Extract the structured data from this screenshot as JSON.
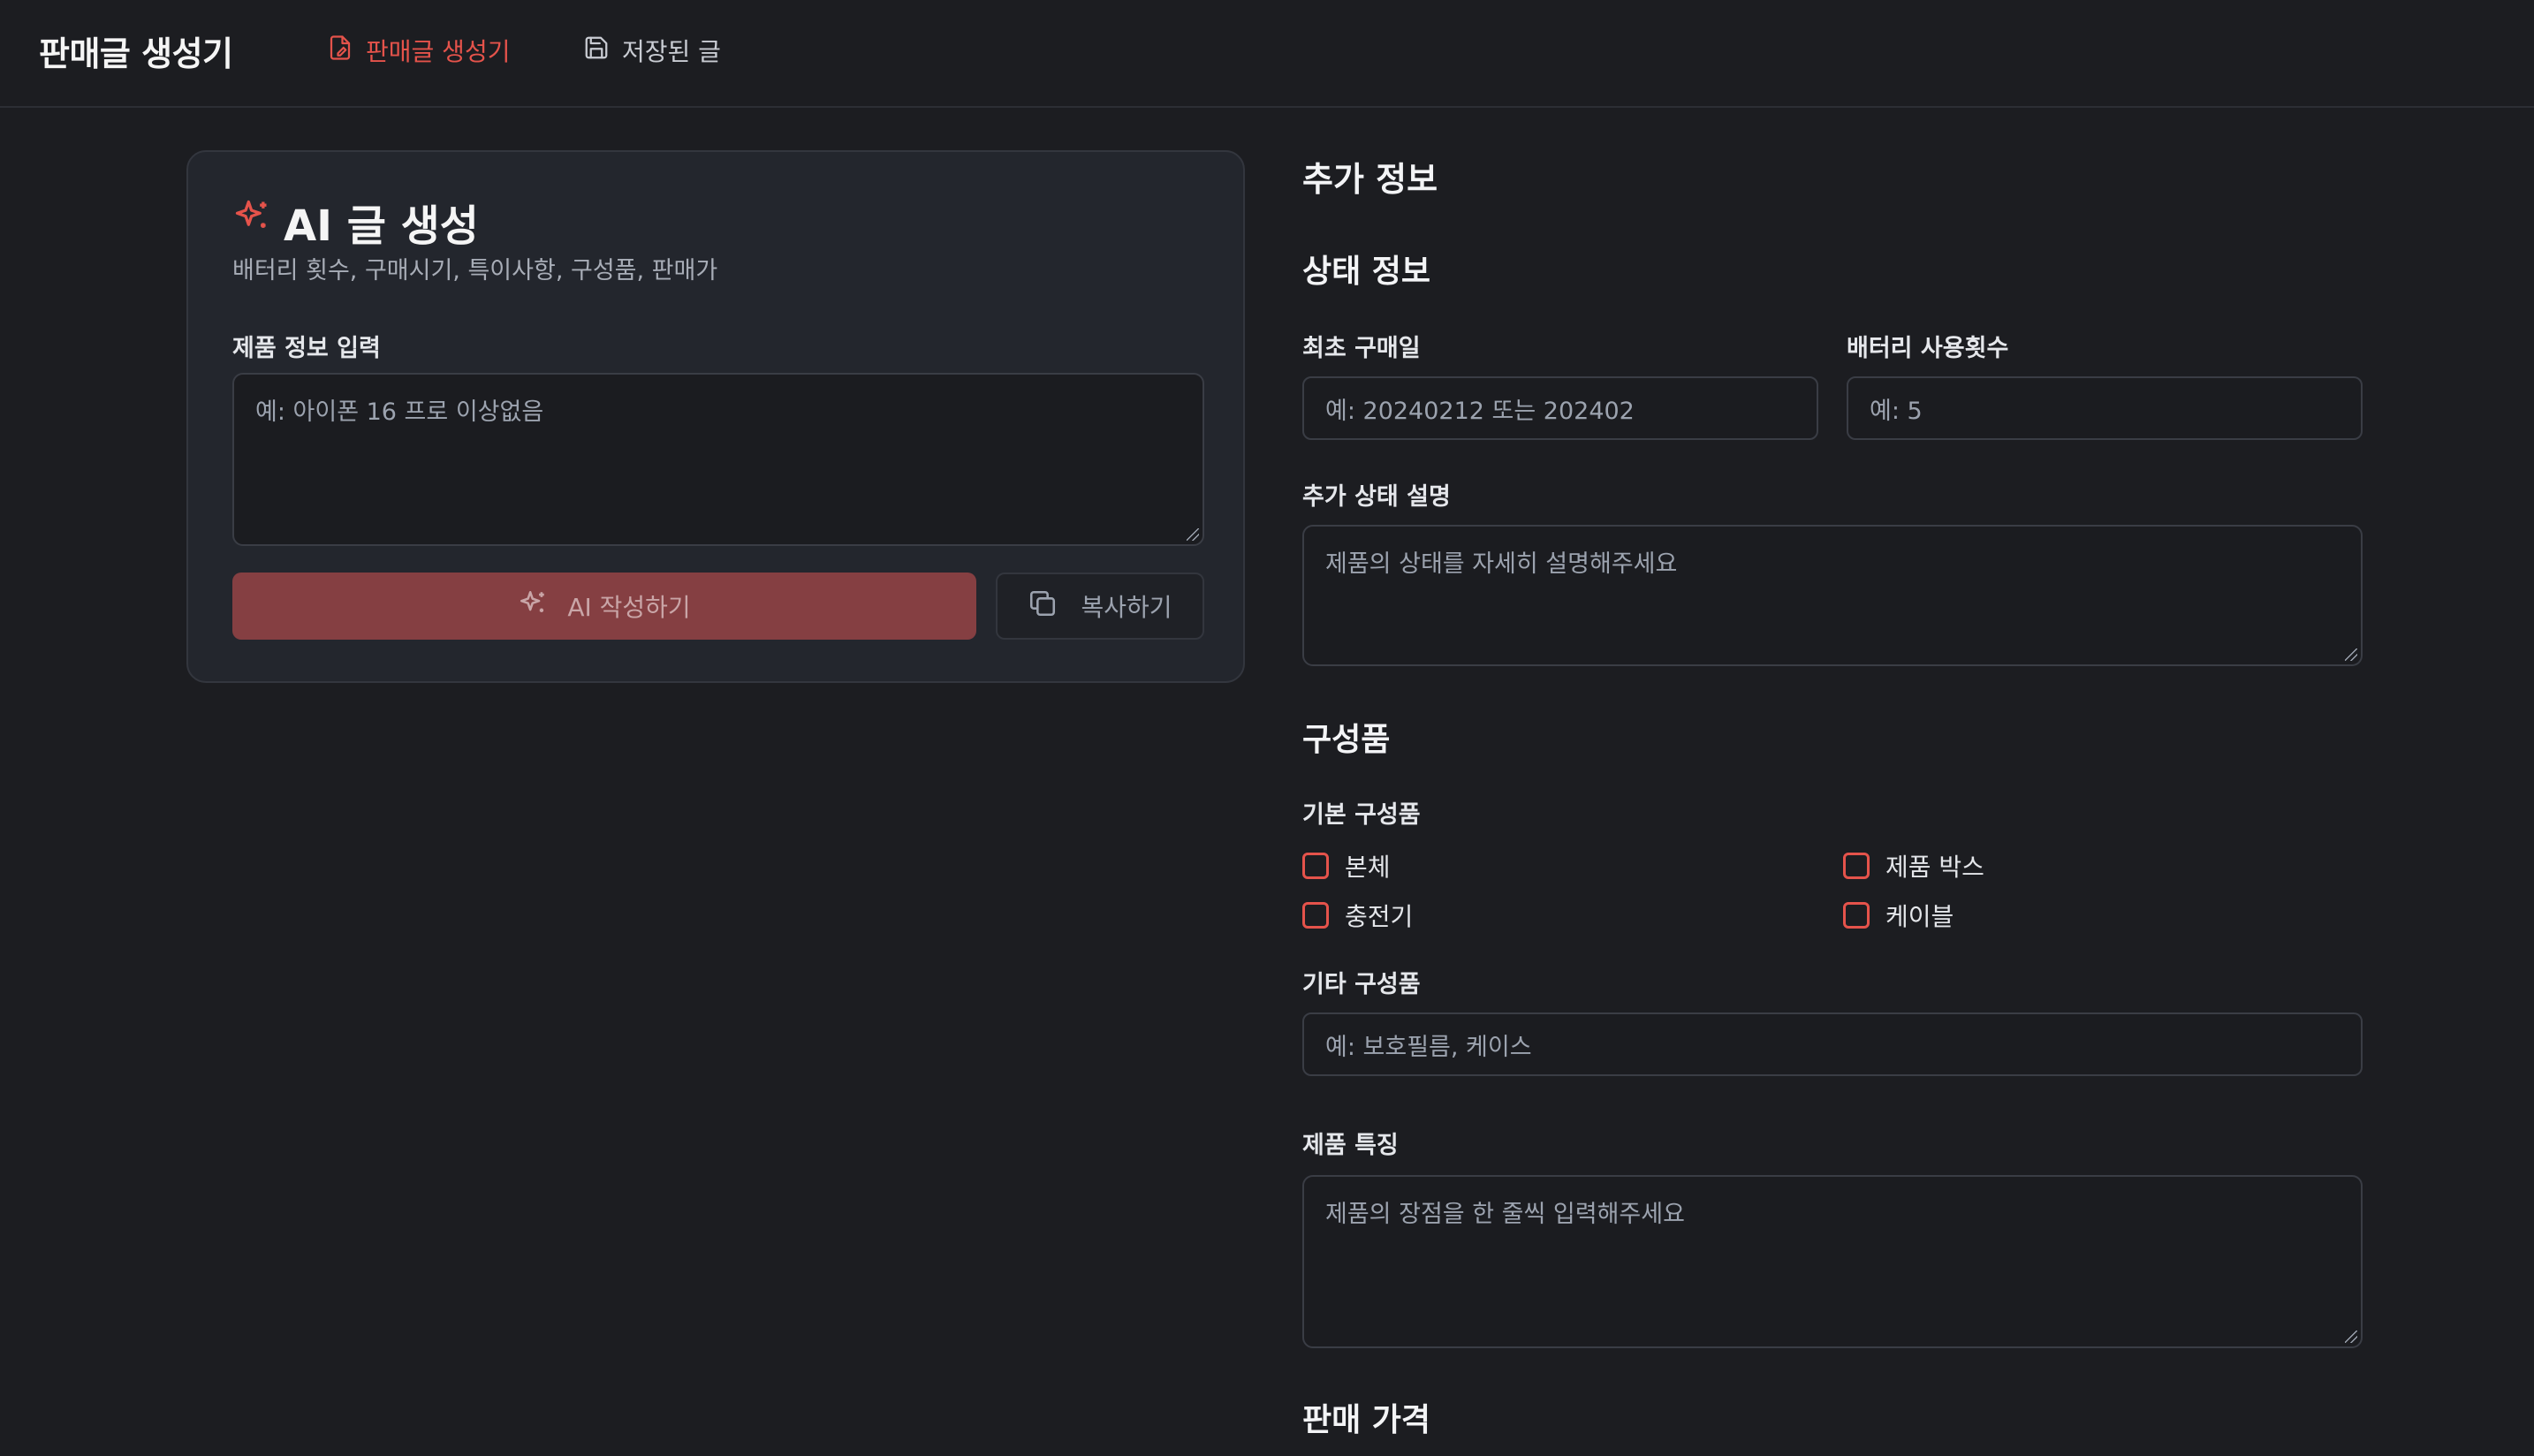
{
  "header": {
    "brand": "판매글 생성기",
    "nav": [
      {
        "label": "판매글 생성기",
        "icon": "document-edit-icon",
        "active": true
      },
      {
        "label": "저장된 글",
        "icon": "save-icon",
        "active": false
      }
    ]
  },
  "generator": {
    "title": "AI 글 생성",
    "subtitle": "배터리 횟수, 구매시기, 특이사항, 구성품, 판매가",
    "input_label": "제품 정보 입력",
    "input_placeholder": "예: 아이폰 16 프로 이상없음",
    "generate_button": "AI 작성하기",
    "copy_button": "복사하기"
  },
  "extra": {
    "title": "추가 정보",
    "status": {
      "title": "상태 정보",
      "purchase_label": "최초 구매일",
      "purchase_placeholder": "예: 20240212 또는 202402",
      "battery_label": "배터리 사용횟수",
      "battery_placeholder": "예: 5",
      "desc_label": "추가 상태 설명",
      "desc_placeholder": "제품의 상태를 자세히 설명해주세요"
    },
    "components": {
      "title": "구성품",
      "basic_label": "기본 구성품",
      "items": [
        "본체",
        "제품 박스",
        "충전기",
        "케이블"
      ],
      "other_label": "기타 구성품",
      "other_placeholder": "예: 보호필름, 케이스"
    },
    "features": {
      "label": "제품 특징",
      "placeholder": "제품의 장점을 한 줄씩 입력해주세요"
    },
    "price": {
      "title": "판매 가격"
    }
  },
  "colors": {
    "accent": "#e5534b",
    "background": "#1c1d21",
    "card": "#23262d",
    "button_primary": "#853f42"
  }
}
